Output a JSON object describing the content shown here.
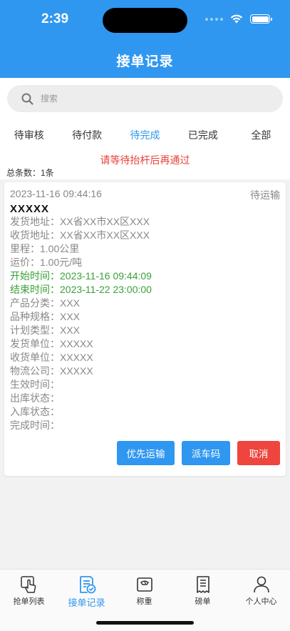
{
  "status": {
    "time": "2:39"
  },
  "header": {
    "title": "接单记录"
  },
  "search": {
    "placeholder": "搜索"
  },
  "tabs": [
    {
      "label": "待审核"
    },
    {
      "label": "待付款"
    },
    {
      "label": "待完成",
      "active": true
    },
    {
      "label": "已完成"
    },
    {
      "label": "全部"
    }
  ],
  "notice": "请等待抬杆后再通过",
  "total": "总条数：1条",
  "record": {
    "datetime": "2023-11-16 09:44:16",
    "status": "待运输",
    "title": "XXXXX",
    "ship_address": "发货地址：XX省XX市XX区XXX",
    "recv_address": "收货地址：XX省XX市XX区XXX",
    "mileage": "里程：1.00公里",
    "freight": "运价：1.00元/吨",
    "start_time": "开始时间：2023-11-16 09:44:09",
    "end_time": "结束时间：2023-11-22 23:00:00",
    "category": "产品分类：XXX",
    "spec": "品种规格：XXX",
    "plan_type": "计划类型：XXX",
    "ship_unit": "发货单位：XXXXX",
    "recv_unit": "收货单位：XXXXX",
    "logistics": "物流公司：XXXXX",
    "effective_time": "生效时间：",
    "out_status": "出库状态：",
    "in_status": "入库状态：",
    "done_time": "完成时间："
  },
  "actions": {
    "priority": "优先运输",
    "dispatch": "派车码",
    "cancel": "取消"
  },
  "tabbar": [
    {
      "label": "抢单列表",
      "icon": "hand-pointer-icon"
    },
    {
      "label": "接单记录",
      "icon": "document-check-icon",
      "active": true
    },
    {
      "label": "称重",
      "icon": "scale-icon"
    },
    {
      "label": "磅单",
      "icon": "receipt-icon"
    },
    {
      "label": "个人中心",
      "icon": "person-icon"
    }
  ],
  "colors": {
    "primary": "#2f97f0",
    "danger": "#ee453e",
    "success": "#3aa13a",
    "notice": "#e8413a"
  }
}
